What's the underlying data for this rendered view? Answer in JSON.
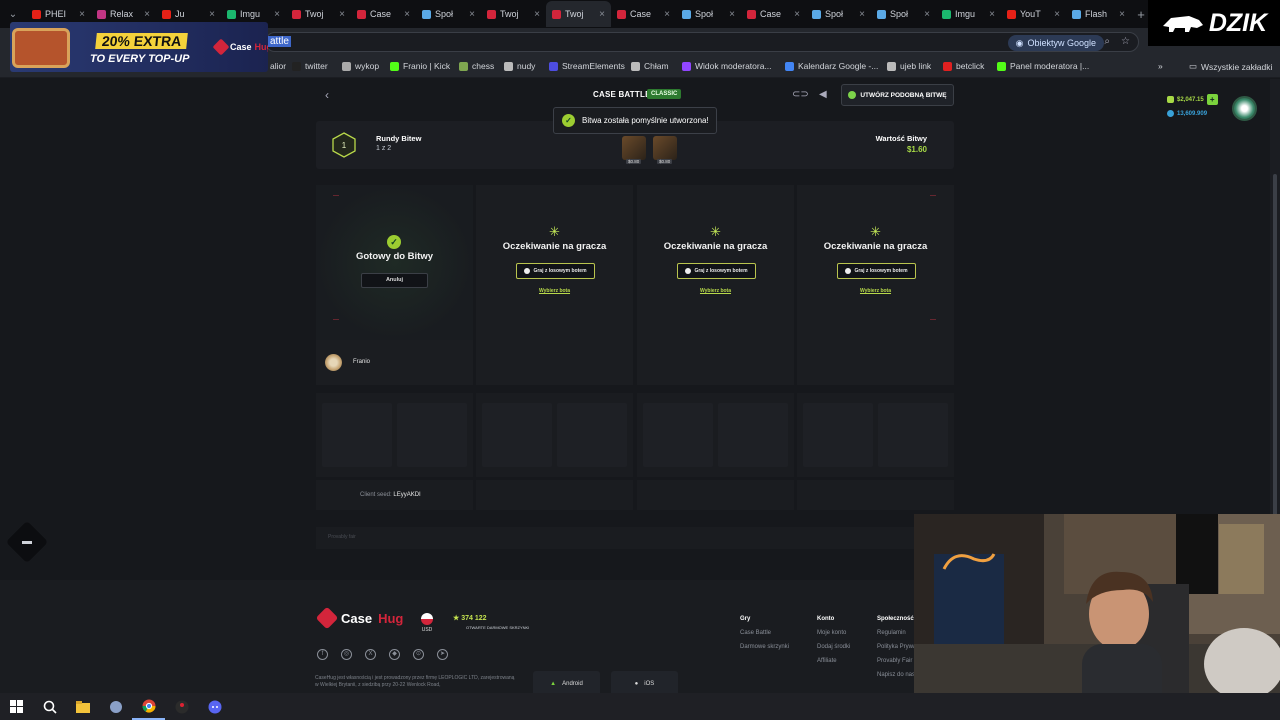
{
  "browser": {
    "tabs": [
      {
        "label": "PHEI",
        "color": "#e62117"
      },
      {
        "label": "Relax",
        "color": "#c13584"
      },
      {
        "label": "Ju",
        "color": "#e62117"
      },
      {
        "label": "Imgu",
        "color": "#1bb76e"
      },
      {
        "label": "Twoj",
        "color": "#d3253b"
      },
      {
        "label": "Case",
        "color": "#d3253b"
      },
      {
        "label": "Społ",
        "color": "#5aa9e6"
      },
      {
        "label": "Twoj",
        "color": "#d3253b"
      },
      {
        "label": "Twoj",
        "color": "#d3253b",
        "active": true
      },
      {
        "label": "Case",
        "color": "#d3253b"
      },
      {
        "label": "Społ",
        "color": "#5aa9e6"
      },
      {
        "label": "Case",
        "color": "#d3253b"
      },
      {
        "label": "Społ",
        "color": "#5aa9e6"
      },
      {
        "label": "Społ",
        "color": "#5aa9e6"
      },
      {
        "label": "Imgu",
        "color": "#1bb76e"
      },
      {
        "label": "YouT",
        "color": "#e62117"
      },
      {
        "label": "Flash",
        "color": "#5aa9e6"
      }
    ],
    "address": "attle",
    "lens_label": "Obiektyw Google",
    "bookmarks": [
      {
        "label": "alior",
        "color": "#c0302b"
      },
      {
        "label": "twitter",
        "color": "#222"
      },
      {
        "label": "wykop",
        "color": "#aaa"
      },
      {
        "label": "Franio | Kick",
        "color": "#53fc18"
      },
      {
        "label": "chess",
        "color": "#7fa650"
      },
      {
        "label": "nudy",
        "color": "#bbb"
      },
      {
        "label": "StreamElements",
        "color": "#4d4de0"
      },
      {
        "label": "Chłam",
        "color": "#bbb"
      },
      {
        "label": "Widok moderatora...",
        "color": "#9146ff"
      },
      {
        "label": "Kalendarz Google -...",
        "color": "#4285f4"
      },
      {
        "label": "ujeb link",
        "color": "#bbb"
      },
      {
        "label": "betclick",
        "color": "#e02020"
      },
      {
        "label": "Panel moderatora |...",
        "color": "#53fc18"
      }
    ],
    "all_bookmarks": "Wszystkie zakładki"
  },
  "ad": {
    "headline": "20% EXTRA",
    "sub": "TO EVERY TOP-UP",
    "brand_a": "Case",
    "brand_b": "Hug"
  },
  "overlay": {
    "brand": "DZIK"
  },
  "battle": {
    "title": "CASE BATTLE",
    "mode": "CLASSIC",
    "create_similar": "UTWÓRZ PODOBNĄ BITWĘ",
    "toast": "Bitwa została pomyślnie utworzona!",
    "round_number": "1",
    "rounds_label": "Rundy Bitew",
    "rounds_value": "1 z 2",
    "value_label": "Wartość Bitwy",
    "value": "$1.60",
    "case_prices": [
      "$0.80",
      "$0.80"
    ],
    "ready_title": "Gotowy do Bitwy",
    "cancel": "Anuluj",
    "waiting": "Oczekiwanie na gracza",
    "play_bot": "Graj z losowym botem",
    "choose_bot": "Wybierz bota",
    "player_name": "Franio",
    "client_seed_label": "Client seed:",
    "client_seed": "LEyyAKDI",
    "provably": "Provably fair"
  },
  "user": {
    "balance": "$2,047.15",
    "coins": "13,609.909"
  },
  "footer": {
    "brand_a": "Case",
    "brand_b": "Hug",
    "currency": "USD",
    "opened_count": "374 122",
    "opened_label": "OTWARTE DARMOWE SKRZYNKI",
    "legal": "CaseHug jest własnością i jest prowadzony przez firmę LEOPLOGIC LTD, zarejestrowaną w Wielkiej Brytanii, z siedzibą przy 20-22 Wenlock Road,",
    "android": "Android",
    "ios": "iOS",
    "col1": {
      "title": "Gry",
      "links": [
        "Case Battle",
        "Darmowe skrzynki"
      ]
    },
    "col2": {
      "title": "Konto",
      "links": [
        "Moje konto",
        "Dodaj środki",
        "Affiliate"
      ]
    },
    "col3": {
      "title": "Społeczność",
      "links": [
        "Regulamin",
        "Polityka Prywatności",
        "Provably Fair",
        "Napisz do nas"
      ]
    }
  }
}
